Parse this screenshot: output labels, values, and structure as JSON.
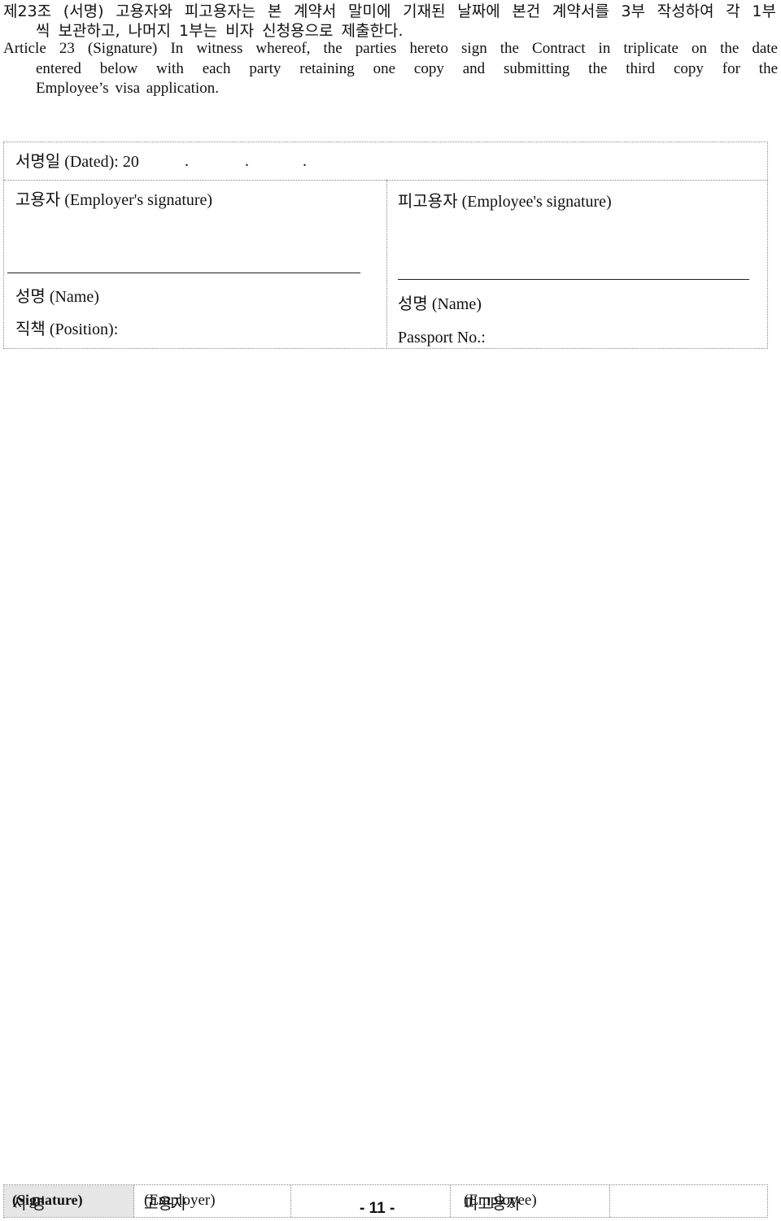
{
  "article": {
    "ko_line1_prefix": "제23조 (서명) 고용자와 피고용자는 본 계약서 말미에 기재된 날짜에 본건 계약서를 3부 작성하여 각 1부",
    "ko_line2": "씩 보관하고, 나머지 1부는 비자 신청용으로 제출한다.",
    "en_line1": "Article 23 (Signature) In witness whereof, the parties hereto sign the Contract in triplicate on the date",
    "en_line2": "entered below with each party retaining one copy and submitting the third copy for the",
    "en_line3": "Employee’s visa application."
  },
  "signature_form": {
    "dated_label_ko": "서명일",
    "dated_label_en": "(Dated):",
    "dated_year_prefix": "20",
    "date_dots": [
      ".",
      ".",
      "."
    ],
    "employer": {
      "heading_ko": "고용자",
      "heading_en": "(Employer's  signature)",
      "name_ko": "성명",
      "name_en": "(Name)",
      "position_ko": "직책",
      "position_en": "(Position):"
    },
    "employee": {
      "heading_ko": "피고용자",
      "heading_en": "(Employee's  signature)",
      "name_ko": "성명",
      "name_en": "(Name)",
      "passport_label": "Passport  No.:"
    }
  },
  "footer": {
    "signature_label_ko": "서 명",
    "signature_label_en": "(Signature)",
    "employer_ko": "고용자",
    "employer_en": "(Employer)",
    "page_number": "- 11 -",
    "employee_ko": "피고용자",
    "employee_en": "(Employee)",
    "signature_cell_bg": "#e6e6e6"
  }
}
